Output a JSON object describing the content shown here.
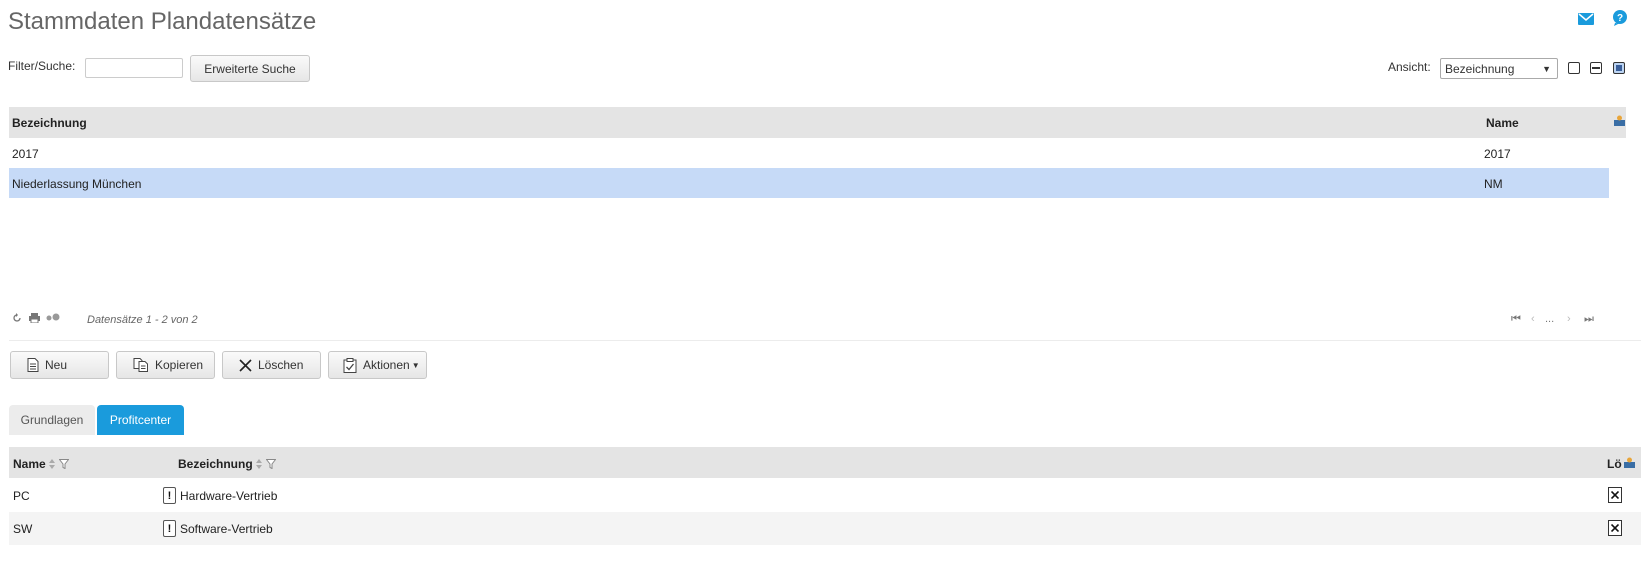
{
  "page": {
    "title": "Stammdaten Plandatensätze"
  },
  "filter": {
    "label": "Filter/Suche:",
    "value": "",
    "extended_search_label": "Erweiterte Suche",
    "view_label": "Ansicht:",
    "view_selected": "Bezeichnung"
  },
  "grid": {
    "columns": [
      "Bezeichnung",
      "Name"
    ],
    "rows": [
      {
        "bezeichnung": "2017",
        "name": "2017",
        "selected": false
      },
      {
        "bezeichnung": "Niederlassung München",
        "name": "NM",
        "selected": true
      }
    ],
    "records_info": "Datensätze 1 - 2 von 2",
    "pager_ellipsis": "..."
  },
  "actions": {
    "new_label": "Neu",
    "copy_label": "Kopieren",
    "delete_label": "Löschen",
    "actions_label": "Aktionen"
  },
  "tabs": [
    {
      "label": "Grundlagen",
      "active": false
    },
    {
      "label": "Profitcenter",
      "active": true
    }
  ],
  "subgrid": {
    "columns": [
      "Name",
      "Bezeichnung",
      "Lö"
    ],
    "rows": [
      {
        "name": "PC",
        "bezeichnung": "Hardware-Vertrieb"
      },
      {
        "name": "SW",
        "bezeichnung": "Software-Vertrieb"
      }
    ]
  },
  "colors": {
    "accent": "#1a9bdc",
    "selected_row": "#c6daf7",
    "header_bg": "#e4e4e4"
  },
  "icons": [
    "mail-icon",
    "help-icon",
    "column-config-icon",
    "refresh-icon",
    "print-icon",
    "settings-icon",
    "first-page-icon",
    "prev-page-icon",
    "next-page-icon",
    "last-page-icon",
    "document-icon",
    "copy-icon",
    "close-icon",
    "clipboard-icon",
    "filter-icon",
    "warning-icon"
  ]
}
